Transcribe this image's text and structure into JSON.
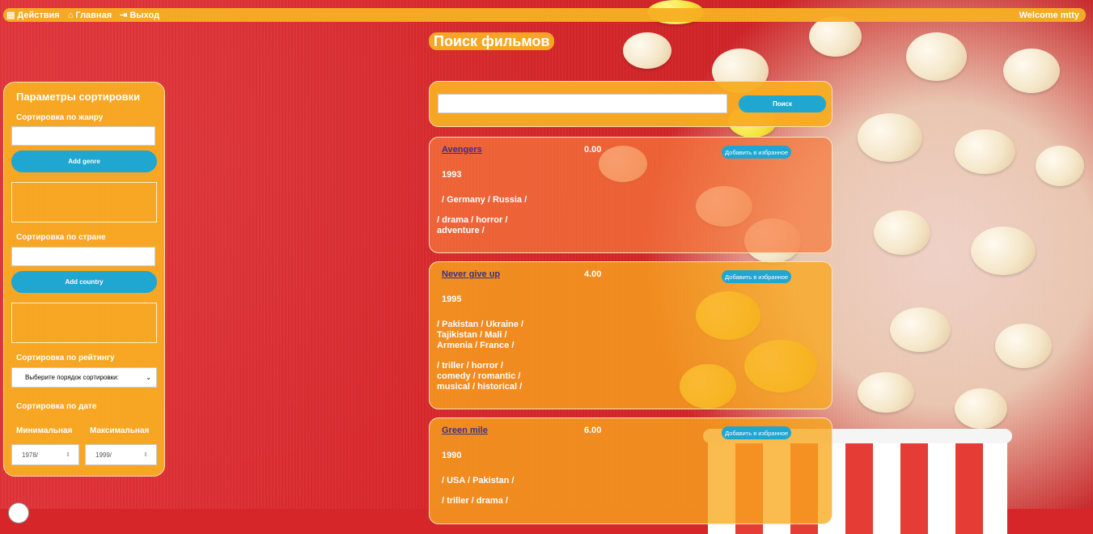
{
  "topbar": {
    "actions_label": "Действия",
    "home_label": "Главная",
    "logout_label": "Выход",
    "welcome_text": "Welcome mtty"
  },
  "page": {
    "title": "Поиск фильмов"
  },
  "sidebar": {
    "heading": "Параметры сортировки",
    "genre_label": "Сортировка по жанру",
    "genre_input_value": "",
    "add_genre_label": "Add genre",
    "country_label": "Сортировка по стране",
    "country_input_value": "",
    "add_country_label": "Add country",
    "rating_label": "Сортировка по рейтингу",
    "rating_select_value": "Выберите порядок сортировки:",
    "date_label": "Сортировка по дате",
    "min_label": "Минимальная",
    "max_label": "Максимальная",
    "min_value": "1978/",
    "max_value": "1999/"
  },
  "search": {
    "input_value": "",
    "button_label": "Поиск"
  },
  "movies": [
    {
      "title": "Avengers",
      "rating": "0.00",
      "fav_label": "Добавить в избранное",
      "year": "1993",
      "countries": "/ Germany / Russia /",
      "genres": "/ drama / horror / adventure /"
    },
    {
      "title": "Never give up",
      "rating": "4.00",
      "fav_label": "Добавить в избранное",
      "year": "1995",
      "countries": "/ Pakistan / Ukraine / Tajikistan / Mali / Armenia / France /",
      "genres": "/ triller / horror / comedy / romantic / musical / historical /"
    },
    {
      "title": "Green mile",
      "rating": "6.00",
      "fav_label": "Добавить в избранное",
      "year": "1990",
      "countries": "/ USA / Pakistan /",
      "genres": "/ triller / drama /"
    }
  ],
  "colors": {
    "accent_orange": "#f7a623",
    "button_blue": "#1fa6d1",
    "background_red": "#d6262a"
  }
}
